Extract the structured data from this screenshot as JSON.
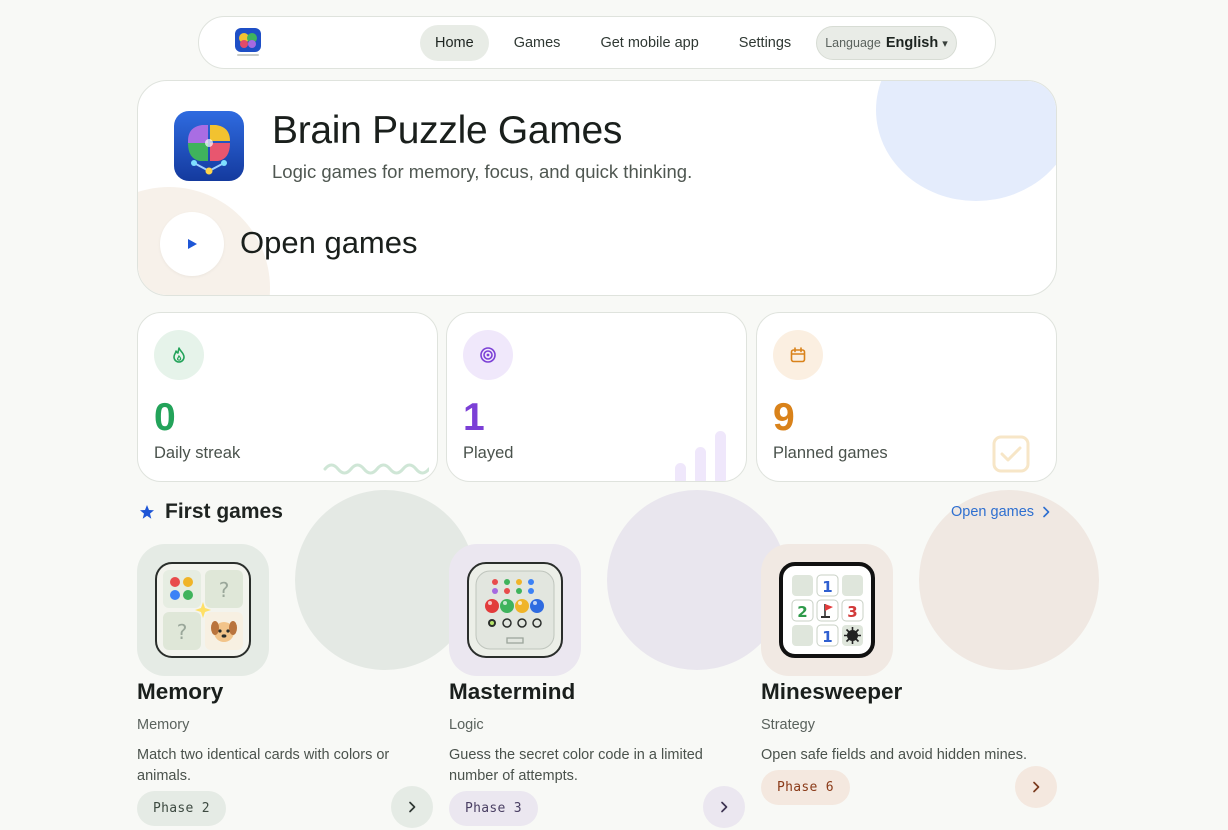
{
  "nav": {
    "logo_icon": "brain-puzzle-logo-icon",
    "items": [
      {
        "label": "Home",
        "active": true
      },
      {
        "label": "Games",
        "active": false
      },
      {
        "label": "Get mobile app",
        "active": false
      },
      {
        "label": "Settings",
        "active": false
      }
    ],
    "language": {
      "label": "Language",
      "value": "English",
      "caret": "▾"
    }
  },
  "hero": {
    "title": "Brain Puzzle Games",
    "subtitle": "Logic games for memory, focus, and quick thinking.",
    "cta": "Open games",
    "icon": "brain-puzzle-app-icon"
  },
  "stats": [
    {
      "value": "0",
      "label": "Daily streak",
      "icon": "flame-icon",
      "color": "#23a35a"
    },
    {
      "value": "1",
      "label": "Played",
      "icon": "target-icon",
      "color": "#7b3fd6"
    },
    {
      "value": "9",
      "label": "Planned games",
      "icon": "calendar-icon",
      "color": "#d9821a"
    }
  ],
  "section": {
    "title": "First games",
    "link": "Open games",
    "icon": "star-icon"
  },
  "games": [
    {
      "name": "Memory",
      "category": "Memory",
      "description": "Match two identical cards with colors or animals.",
      "phase_label": "Phase",
      "phase": "2",
      "icon": "memory-cards-icon"
    },
    {
      "name": "Mastermind",
      "category": "Logic",
      "description": "Guess the secret color code in a limited number of attempts.",
      "phase_label": "Phase",
      "phase": "3",
      "icon": "mastermind-board-icon"
    },
    {
      "name": "Minesweeper",
      "category": "Strategy",
      "description": "Open safe fields and avoid hidden mines.",
      "phase_label": "Phase",
      "phase": "6",
      "icon": "minesweeper-grid-icon"
    }
  ],
  "minesweeper_tile": [
    "1",
    "2",
    "3",
    "1"
  ],
  "colors": {
    "accent_blue": "#2e6fd0",
    "green": "#23a35a",
    "purple": "#7b3fd6",
    "orange": "#d9821a"
  }
}
